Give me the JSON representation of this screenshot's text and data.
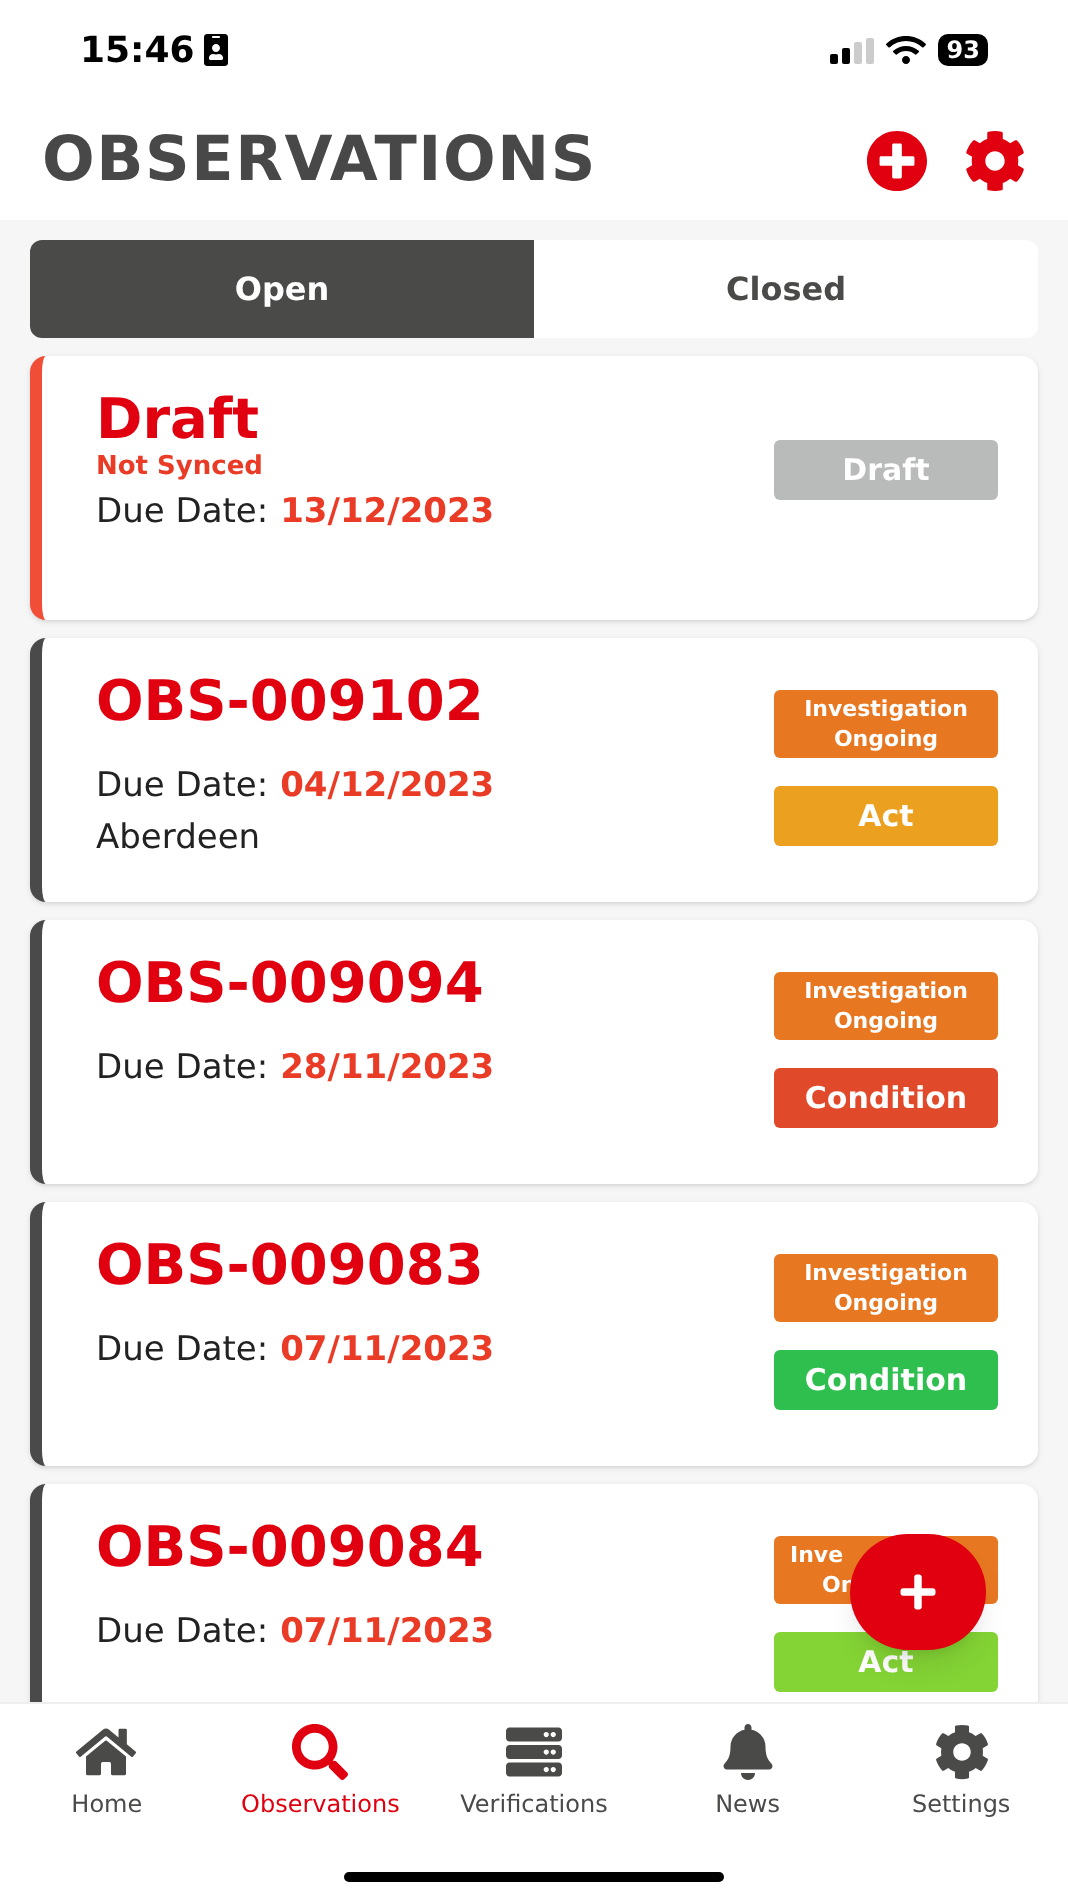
{
  "status_bar": {
    "time": "15:46",
    "battery": "93"
  },
  "header": {
    "title": "OBSERVATIONS"
  },
  "tabs": [
    {
      "label": "Open",
      "selected": true
    },
    {
      "label": "Closed",
      "selected": false
    }
  ],
  "cards": [
    {
      "title": "Draft",
      "subtitle": "Not Synced",
      "due_label": "Due Date:",
      "due_date": "13/12/2023",
      "color": "#f04e37",
      "badges": [
        {
          "label": "Draft",
          "color": "#b9bbba"
        }
      ]
    },
    {
      "title": "OBS-009102",
      "due_label": "Due Date:",
      "due_date": "04/12/2023",
      "location": "Aberdeen",
      "color": "#4a4a4a",
      "badges": [
        {
          "label": "Investigation Ongoing",
          "color": "#e87722"
        },
        {
          "label": "Act",
          "color": "#eba020"
        }
      ]
    },
    {
      "title": "OBS-009094",
      "due_label": "Due Date:",
      "due_date": "28/11/2023",
      "color": "#4a4a4a",
      "badges": [
        {
          "label": "Investigation Ongoing",
          "color": "#e87722"
        },
        {
          "label": "Condition",
          "color": "#e04a2a"
        }
      ]
    },
    {
      "title": "OBS-009083",
      "due_label": "Due Date:",
      "due_date": "07/11/2023",
      "color": "#4a4a4a",
      "badges": [
        {
          "label": "Investigation Ongoing",
          "color": "#e87722"
        },
        {
          "label": "Condition",
          "color": "#2fbf4f"
        }
      ]
    },
    {
      "title": "OBS-009084",
      "due_label": "Due Date:",
      "due_date": "07/11/2023",
      "color": "#4a4a4a",
      "badges": [
        {
          "lines": [
            "Inve",
            "On"
          ],
          "color": "#e87722"
        },
        {
          "label": "Act",
          "color": "#84d435"
        }
      ]
    }
  ],
  "nav": [
    {
      "label": "Home",
      "kind": "home",
      "selected": false
    },
    {
      "label": "Observations",
      "kind": "search",
      "selected": true
    },
    {
      "label": "Verifications",
      "kind": "server",
      "selected": false
    },
    {
      "label": "News",
      "kind": "bell",
      "selected": false
    },
    {
      "label": "Settings",
      "kind": "gear",
      "selected": false
    }
  ]
}
